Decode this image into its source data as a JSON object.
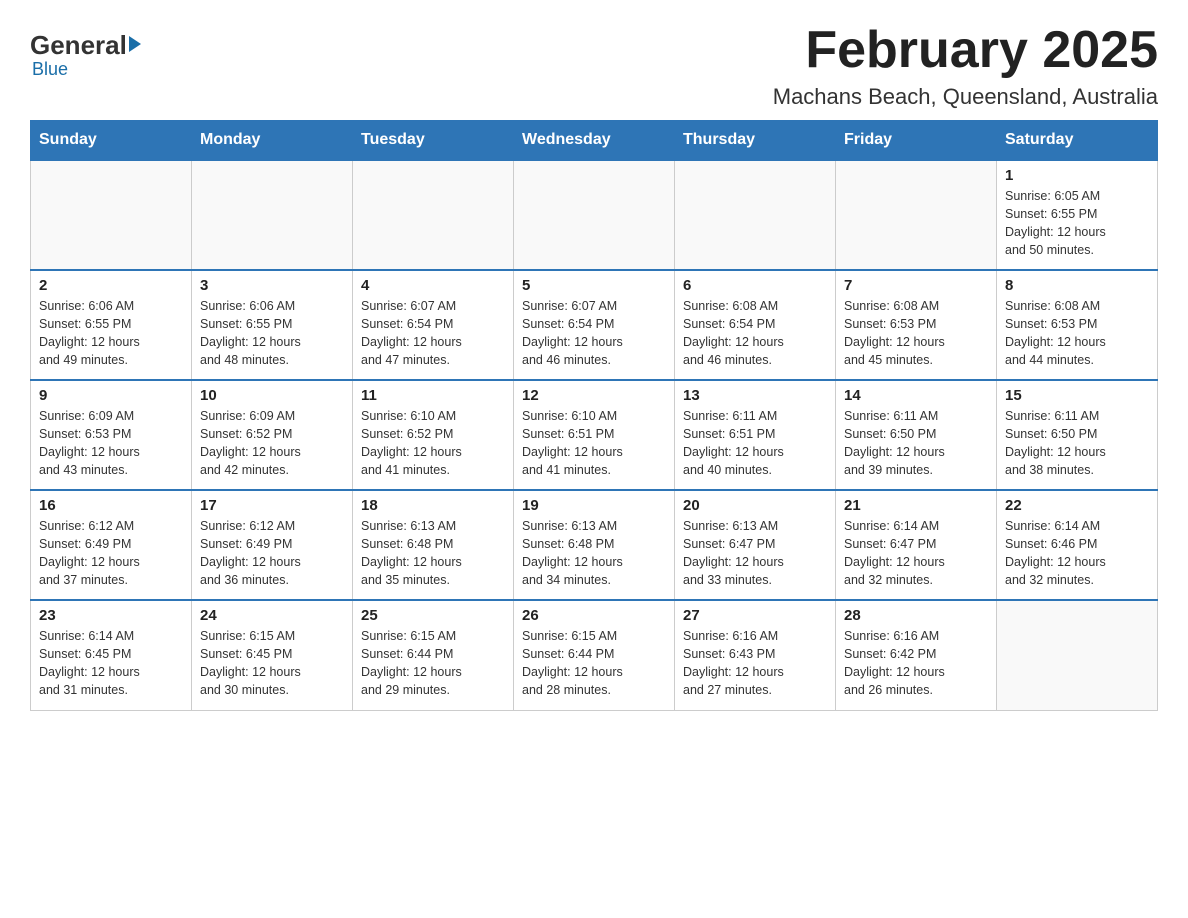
{
  "logo": {
    "general": "General",
    "blue": "Blue"
  },
  "title": "February 2025",
  "subtitle": "Machans Beach, Queensland, Australia",
  "days_of_week": [
    "Sunday",
    "Monday",
    "Tuesday",
    "Wednesday",
    "Thursday",
    "Friday",
    "Saturday"
  ],
  "weeks": [
    [
      {
        "day": "",
        "info": ""
      },
      {
        "day": "",
        "info": ""
      },
      {
        "day": "",
        "info": ""
      },
      {
        "day": "",
        "info": ""
      },
      {
        "day": "",
        "info": ""
      },
      {
        "day": "",
        "info": ""
      },
      {
        "day": "1",
        "info": "Sunrise: 6:05 AM\nSunset: 6:55 PM\nDaylight: 12 hours\nand 50 minutes."
      }
    ],
    [
      {
        "day": "2",
        "info": "Sunrise: 6:06 AM\nSunset: 6:55 PM\nDaylight: 12 hours\nand 49 minutes."
      },
      {
        "day": "3",
        "info": "Sunrise: 6:06 AM\nSunset: 6:55 PM\nDaylight: 12 hours\nand 48 minutes."
      },
      {
        "day": "4",
        "info": "Sunrise: 6:07 AM\nSunset: 6:54 PM\nDaylight: 12 hours\nand 47 minutes."
      },
      {
        "day": "5",
        "info": "Sunrise: 6:07 AM\nSunset: 6:54 PM\nDaylight: 12 hours\nand 46 minutes."
      },
      {
        "day": "6",
        "info": "Sunrise: 6:08 AM\nSunset: 6:54 PM\nDaylight: 12 hours\nand 46 minutes."
      },
      {
        "day": "7",
        "info": "Sunrise: 6:08 AM\nSunset: 6:53 PM\nDaylight: 12 hours\nand 45 minutes."
      },
      {
        "day": "8",
        "info": "Sunrise: 6:08 AM\nSunset: 6:53 PM\nDaylight: 12 hours\nand 44 minutes."
      }
    ],
    [
      {
        "day": "9",
        "info": "Sunrise: 6:09 AM\nSunset: 6:53 PM\nDaylight: 12 hours\nand 43 minutes."
      },
      {
        "day": "10",
        "info": "Sunrise: 6:09 AM\nSunset: 6:52 PM\nDaylight: 12 hours\nand 42 minutes."
      },
      {
        "day": "11",
        "info": "Sunrise: 6:10 AM\nSunset: 6:52 PM\nDaylight: 12 hours\nand 41 minutes."
      },
      {
        "day": "12",
        "info": "Sunrise: 6:10 AM\nSunset: 6:51 PM\nDaylight: 12 hours\nand 41 minutes."
      },
      {
        "day": "13",
        "info": "Sunrise: 6:11 AM\nSunset: 6:51 PM\nDaylight: 12 hours\nand 40 minutes."
      },
      {
        "day": "14",
        "info": "Sunrise: 6:11 AM\nSunset: 6:50 PM\nDaylight: 12 hours\nand 39 minutes."
      },
      {
        "day": "15",
        "info": "Sunrise: 6:11 AM\nSunset: 6:50 PM\nDaylight: 12 hours\nand 38 minutes."
      }
    ],
    [
      {
        "day": "16",
        "info": "Sunrise: 6:12 AM\nSunset: 6:49 PM\nDaylight: 12 hours\nand 37 minutes."
      },
      {
        "day": "17",
        "info": "Sunrise: 6:12 AM\nSunset: 6:49 PM\nDaylight: 12 hours\nand 36 minutes."
      },
      {
        "day": "18",
        "info": "Sunrise: 6:13 AM\nSunset: 6:48 PM\nDaylight: 12 hours\nand 35 minutes."
      },
      {
        "day": "19",
        "info": "Sunrise: 6:13 AM\nSunset: 6:48 PM\nDaylight: 12 hours\nand 34 minutes."
      },
      {
        "day": "20",
        "info": "Sunrise: 6:13 AM\nSunset: 6:47 PM\nDaylight: 12 hours\nand 33 minutes."
      },
      {
        "day": "21",
        "info": "Sunrise: 6:14 AM\nSunset: 6:47 PM\nDaylight: 12 hours\nand 32 minutes."
      },
      {
        "day": "22",
        "info": "Sunrise: 6:14 AM\nSunset: 6:46 PM\nDaylight: 12 hours\nand 32 minutes."
      }
    ],
    [
      {
        "day": "23",
        "info": "Sunrise: 6:14 AM\nSunset: 6:45 PM\nDaylight: 12 hours\nand 31 minutes."
      },
      {
        "day": "24",
        "info": "Sunrise: 6:15 AM\nSunset: 6:45 PM\nDaylight: 12 hours\nand 30 minutes."
      },
      {
        "day": "25",
        "info": "Sunrise: 6:15 AM\nSunset: 6:44 PM\nDaylight: 12 hours\nand 29 minutes."
      },
      {
        "day": "26",
        "info": "Sunrise: 6:15 AM\nSunset: 6:44 PM\nDaylight: 12 hours\nand 28 minutes."
      },
      {
        "day": "27",
        "info": "Sunrise: 6:16 AM\nSunset: 6:43 PM\nDaylight: 12 hours\nand 27 minutes."
      },
      {
        "day": "28",
        "info": "Sunrise: 6:16 AM\nSunset: 6:42 PM\nDaylight: 12 hours\nand 26 minutes."
      },
      {
        "day": "",
        "info": ""
      }
    ]
  ]
}
